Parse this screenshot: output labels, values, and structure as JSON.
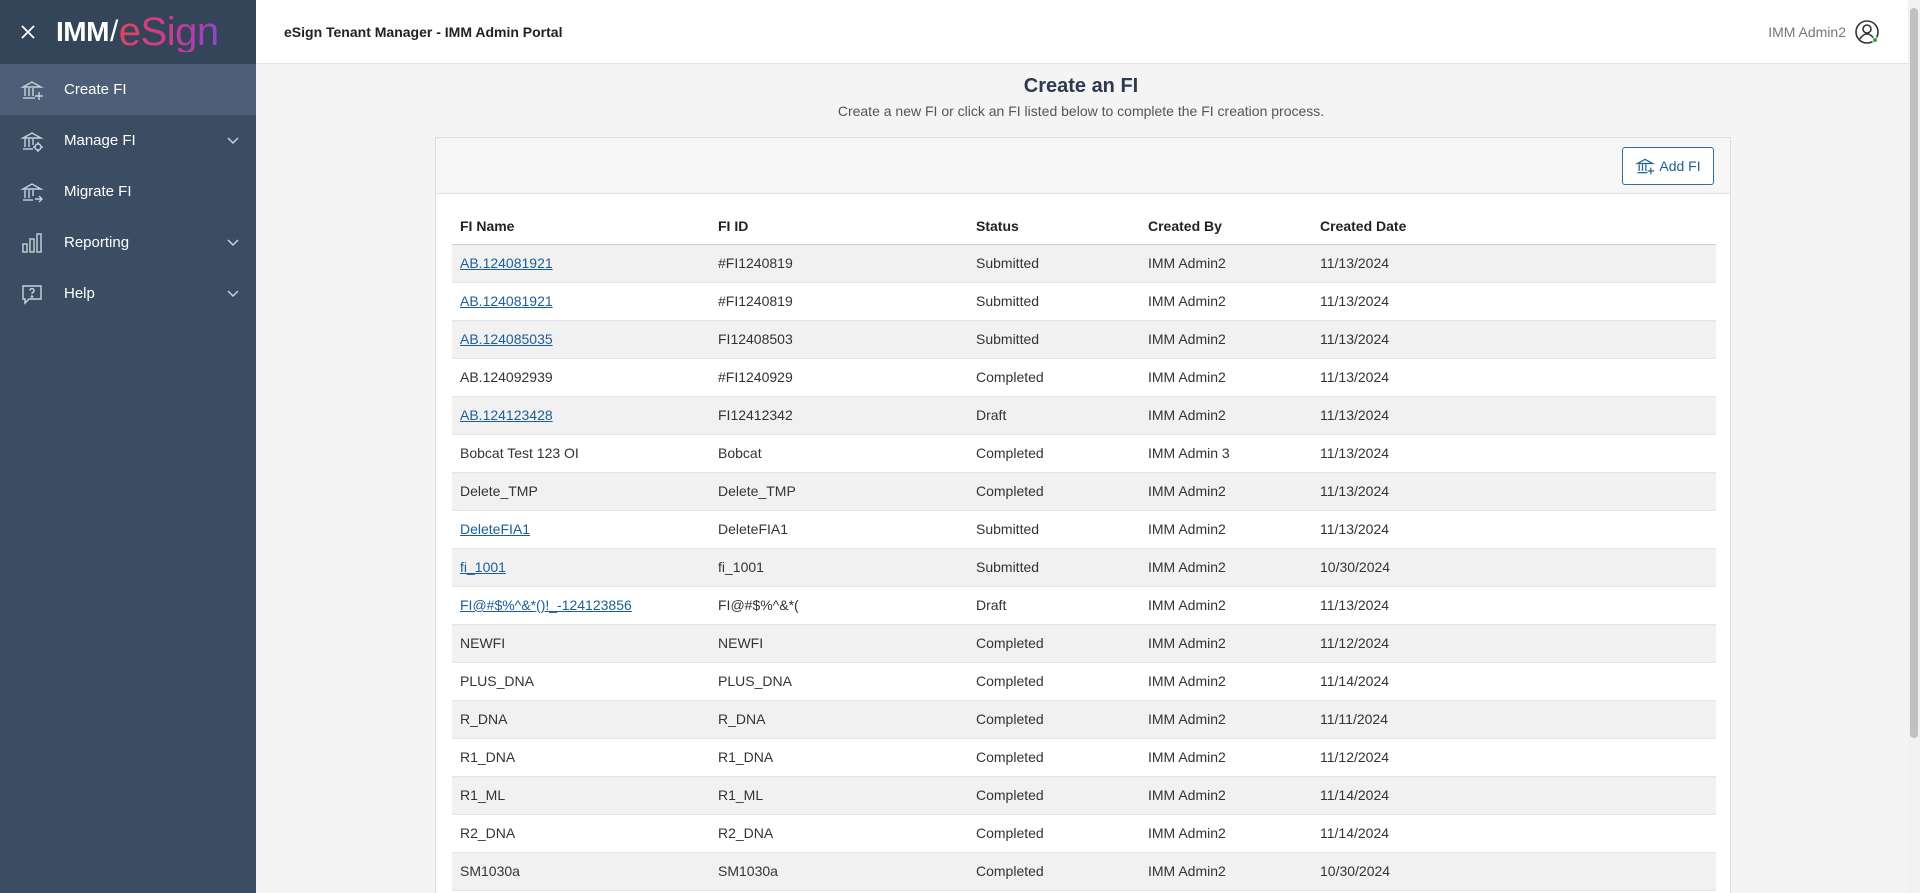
{
  "sidebar": {
    "logo_left": "IMM",
    "logo_slash": "/",
    "logo_right": "eSign",
    "items": [
      {
        "label": "Create FI",
        "icon": "bank-plus-icon",
        "active": true,
        "expandable": false
      },
      {
        "label": "Manage FI",
        "icon": "bank-gear-icon",
        "active": false,
        "expandable": true
      },
      {
        "label": "Migrate FI",
        "icon": "bank-arrow-icon",
        "active": false,
        "expandable": false
      },
      {
        "label": "Reporting",
        "icon": "bar-chart-icon",
        "active": false,
        "expandable": true
      },
      {
        "label": "Help",
        "icon": "help-bubble-icon",
        "active": false,
        "expandable": true
      }
    ]
  },
  "header": {
    "title": "eSign Tenant Manager - IMM Admin Portal",
    "user_name": "IMM Admin2"
  },
  "main": {
    "title": "Create an FI",
    "subtitle": "Create a new FI or click an FI listed below to complete the FI creation process.",
    "add_button_label": "Add FI",
    "columns": [
      "FI Name",
      "FI ID",
      "Status",
      "Created By",
      "Created Date"
    ],
    "rows": [
      {
        "name": "AB.124081921",
        "link": true,
        "id": "#FI1240819",
        "status": "Submitted",
        "created_by": "IMM Admin2",
        "date": "11/13/2024"
      },
      {
        "name": "AB.124081921",
        "link": true,
        "id": "#FI1240819",
        "status": "Submitted",
        "created_by": "IMM Admin2",
        "date": "11/13/2024"
      },
      {
        "name": "AB.124085035",
        "link": true,
        "id": "FI12408503",
        "status": "Submitted",
        "created_by": "IMM Admin2",
        "date": "11/13/2024"
      },
      {
        "name": "AB.124092939",
        "link": false,
        "id": "#FI1240929",
        "status": "Completed",
        "created_by": "IMM Admin2",
        "date": "11/13/2024"
      },
      {
        "name": "AB.124123428",
        "link": true,
        "id": "FI12412342",
        "status": "Draft",
        "created_by": "IMM Admin2",
        "date": "11/13/2024"
      },
      {
        "name": "Bobcat Test 123 OI",
        "link": false,
        "id": "Bobcat",
        "status": "Completed",
        "created_by": "IMM Admin 3",
        "date": "11/13/2024"
      },
      {
        "name": "Delete_TMP",
        "link": false,
        "id": "Delete_TMP",
        "status": "Completed",
        "created_by": "IMM Admin2",
        "date": "11/13/2024"
      },
      {
        "name": "DeleteFIA1",
        "link": true,
        "id": "DeleteFIA1",
        "status": "Submitted",
        "created_by": "IMM Admin2",
        "date": "11/13/2024"
      },
      {
        "name": "fi_1001",
        "link": true,
        "id": "fi_1001",
        "status": "Submitted",
        "created_by": "IMM Admin2",
        "date": "10/30/2024"
      },
      {
        "name": "FI@#$%^&*()!_-124123856",
        "link": true,
        "id": "FI@#$%^&*(",
        "status": "Draft",
        "created_by": "IMM Admin2",
        "date": "11/13/2024"
      },
      {
        "name": "NEWFI",
        "link": false,
        "id": "NEWFI",
        "status": "Completed",
        "created_by": "IMM Admin2",
        "date": "11/12/2024"
      },
      {
        "name": "PLUS_DNA",
        "link": false,
        "id": "PLUS_DNA",
        "status": "Completed",
        "created_by": "IMM Admin2",
        "date": "11/14/2024"
      },
      {
        "name": "R_DNA",
        "link": false,
        "id": "R_DNA",
        "status": "Completed",
        "created_by": "IMM Admin2",
        "date": "11/11/2024"
      },
      {
        "name": "R1_DNA",
        "link": false,
        "id": "R1_DNA",
        "status": "Completed",
        "created_by": "IMM Admin2",
        "date": "11/12/2024"
      },
      {
        "name": "R1_ML",
        "link": false,
        "id": "R1_ML",
        "status": "Completed",
        "created_by": "IMM Admin2",
        "date": "11/14/2024"
      },
      {
        "name": "R2_DNA",
        "link": false,
        "id": "R2_DNA",
        "status": "Completed",
        "created_by": "IMM Admin2",
        "date": "11/14/2024"
      },
      {
        "name": "SM1030a",
        "link": false,
        "id": "SM1030a",
        "status": "Completed",
        "created_by": "IMM Admin2",
        "date": "10/30/2024"
      }
    ]
  },
  "colors": {
    "sidebar_bg": "#3b4d63",
    "sidebar_active": "#4c5f77",
    "link": "#1a5e9a",
    "accent_button": "#2c6ea6"
  }
}
